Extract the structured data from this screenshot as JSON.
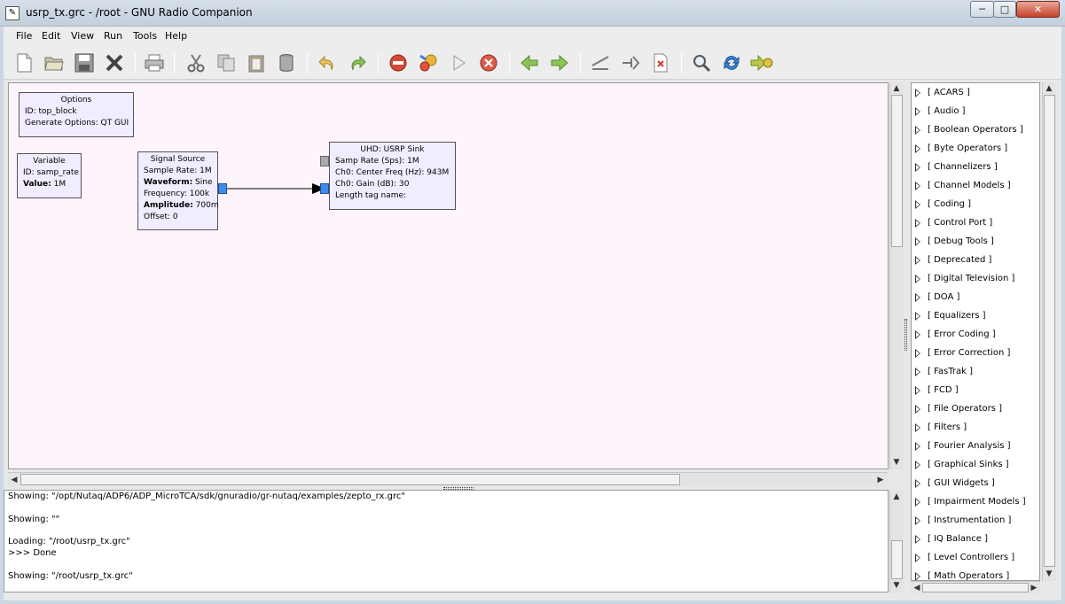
{
  "window": {
    "title": "usrp_tx.grc - /root - GNU Radio Companion",
    "minimize": "─",
    "maximize": "□",
    "close": "✕"
  },
  "menu": {
    "file": "File",
    "edit": "Edit",
    "view": "View",
    "run": "Run",
    "tools": "Tools",
    "help": "Help"
  },
  "toolbar": {
    "icons": [
      "new-file-icon",
      "open-file-icon",
      "save-icon",
      "close-icon",
      "print-icon",
      "cut-icon",
      "copy-icon",
      "paste-icon",
      "delete-icon",
      "undo-icon",
      "redo-icon",
      "errors-icon",
      "generate-icon",
      "execute-icon",
      "kill-icon",
      "move-left-icon",
      "move-right-icon",
      "disable-icon",
      "enable-icon",
      "bypass-icon",
      "find-icon",
      "reload-icon",
      "flow-graph-icon"
    ]
  },
  "blocks": {
    "options": {
      "title": "Options",
      "id": "ID: top_block",
      "gen": "Generate Options: QT GUI"
    },
    "variable": {
      "title": "Variable",
      "id_k": "ID:",
      "id_v": " samp_rate",
      "val_k": "Value:",
      "val_v": " 1M"
    },
    "signal": {
      "title": "Signal Source",
      "sr": "Sample Rate: 1M",
      "wf_k": "Waveform:",
      "wf_v": " Sine",
      "fq": "Frequency: 100k",
      "amp_k": "Amplitude:",
      "amp_v": " 700m",
      "off": "Offset: 0"
    },
    "usrp": {
      "title": "UHD: USRP Sink",
      "samp": "Samp Rate (Sps): 1M",
      "cf": "Ch0: Center Freq (Hz): 943M",
      "gain": "Ch0: Gain (dB): 30",
      "tag": "Length tag name:"
    }
  },
  "console": {
    "line1": "Showing: \"/opt/Nutaq/ADP6/ADP_MicroTCA/sdk/gnuradio/gr-nutaq/examples/zepto_rx.grc\"",
    "line2": "Showing: \"\"",
    "line3": "Loading: \"/root/usrp_tx.grc\"",
    "line4": ">>> Done",
    "line5": "Showing: \"/root/usrp_tx.grc\""
  },
  "tree": {
    "items": [
      "[ ACARS ]",
      "[ Audio ]",
      "[ Boolean Operators ]",
      "[ Byte Operators ]",
      "[ Channelizers ]",
      "[ Channel Models ]",
      "[ Coding ]",
      "[ Control Port ]",
      "[ Debug Tools ]",
      "[ Deprecated ]",
      "[ Digital Television ]",
      "[ DOA ]",
      "[ Equalizers ]",
      "[ Error Coding ]",
      "[ Error Correction ]",
      "[ FasTrak ]",
      "[ FCD ]",
      "[ File Operators ]",
      "[ Filters ]",
      "[ Fourier Analysis ]",
      "[ Graphical Sinks ]",
      "[ GUI Widgets ]",
      "[ Impairment Models ]",
      "[ Instrumentation ]",
      "[ IQ Balance ]",
      "[ Level Controllers ]",
      "[ Math Operators ]"
    ]
  }
}
